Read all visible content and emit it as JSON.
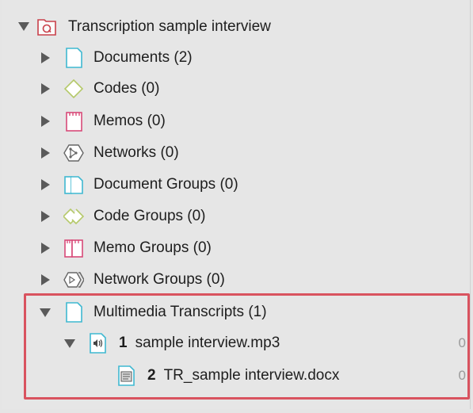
{
  "tree": {
    "root": {
      "label": "Transcription sample interview",
      "icon": "project-icon"
    },
    "items": [
      {
        "label": "Documents (2)",
        "icon": "document-icon"
      },
      {
        "label": "Codes (0)",
        "icon": "code-icon"
      },
      {
        "label": "Memos (0)",
        "icon": "memo-icon"
      },
      {
        "label": "Networks (0)",
        "icon": "network-icon"
      },
      {
        "label": "Document Groups (0)",
        "icon": "document-group-icon"
      },
      {
        "label": "Code Groups (0)",
        "icon": "code-group-icon"
      },
      {
        "label": "Memo Groups (0)",
        "icon": "memo-group-icon"
      },
      {
        "label": "Network Groups (0)",
        "icon": "network-group-icon"
      },
      {
        "label": "Multimedia Transcripts (1)",
        "icon": "document-icon"
      }
    ],
    "media": {
      "num": "1",
      "label": "sample interview.mp3",
      "count": "0",
      "icon": "audio-file-icon"
    },
    "transcript": {
      "num": "2",
      "label": "TR_sample interview.docx",
      "count": "0",
      "icon": "docx-file-icon"
    }
  },
  "colors": {
    "highlight": "#d9535f",
    "background": "#e6e6e6"
  }
}
